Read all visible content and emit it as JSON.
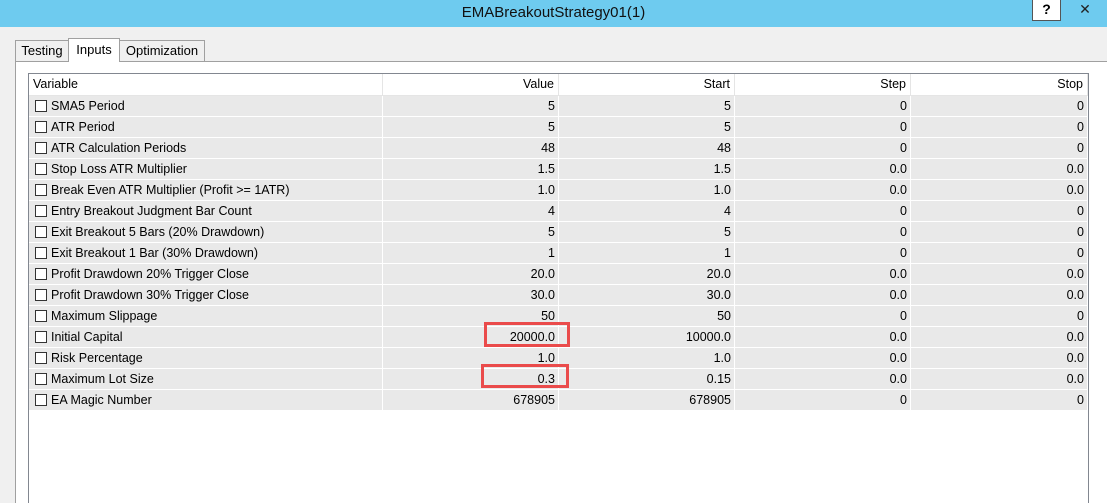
{
  "window": {
    "title": "EMABreakoutStrategy01(1)",
    "help_label": "?",
    "close_label": "✕"
  },
  "tabs": [
    {
      "label": "Testing",
      "active": false
    },
    {
      "label": "Inputs",
      "active": true
    },
    {
      "label": "Optimization",
      "active": false
    }
  ],
  "table": {
    "columns": [
      "Variable",
      "Value",
      "Start",
      "Step",
      "Stop"
    ],
    "rows": [
      {
        "variable": "SMA5 Period",
        "value": "5",
        "start": "5",
        "step": "0",
        "stop": "0"
      },
      {
        "variable": "ATR Period",
        "value": "5",
        "start": "5",
        "step": "0",
        "stop": "0"
      },
      {
        "variable": "ATR Calculation Periods",
        "value": "48",
        "start": "48",
        "step": "0",
        "stop": "0"
      },
      {
        "variable": "Stop Loss ATR Multiplier",
        "value": "1.5",
        "start": "1.5",
        "step": "0.0",
        "stop": "0.0"
      },
      {
        "variable": "Break Even ATR Multiplier (Profit >= 1ATR)",
        "value": "1.0",
        "start": "1.0",
        "step": "0.0",
        "stop": "0.0"
      },
      {
        "variable": "Entry Breakout Judgment Bar Count",
        "value": "4",
        "start": "4",
        "step": "0",
        "stop": "0"
      },
      {
        "variable": "Exit Breakout 5 Bars (20% Drawdown)",
        "value": "5",
        "start": "5",
        "step": "0",
        "stop": "0"
      },
      {
        "variable": "Exit Breakout 1 Bar (30% Drawdown)",
        "value": "1",
        "start": "1",
        "step": "0",
        "stop": "0"
      },
      {
        "variable": "Profit Drawdown 20% Trigger Close",
        "value": "20.0",
        "start": "20.0",
        "step": "0.0",
        "stop": "0.0"
      },
      {
        "variable": "Profit Drawdown 30% Trigger Close",
        "value": "30.0",
        "start": "30.0",
        "step": "0.0",
        "stop": "0.0"
      },
      {
        "variable": "Maximum Slippage",
        "value": "50",
        "start": "50",
        "step": "0",
        "stop": "0"
      },
      {
        "variable": "Initial Capital",
        "value": "20000.0",
        "start": "10000.0",
        "step": "0.0",
        "stop": "0.0"
      },
      {
        "variable": "Risk Percentage",
        "value": "1.0",
        "start": "1.0",
        "step": "0.0",
        "stop": "0.0"
      },
      {
        "variable": "Maximum Lot Size",
        "value": "0.3",
        "start": "0.15",
        "step": "0.0",
        "stop": "0.0"
      },
      {
        "variable": "EA Magic Number",
        "value": "678905",
        "start": "678905",
        "step": "0",
        "stop": "0"
      }
    ]
  },
  "highlight_color": "#ea4b4b"
}
